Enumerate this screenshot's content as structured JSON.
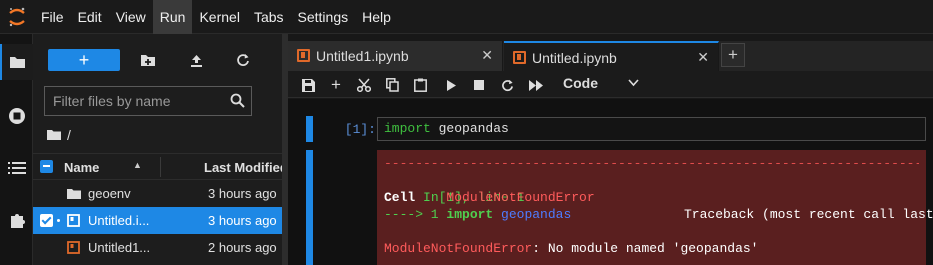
{
  "menu": [
    "File",
    "Edit",
    "View",
    "Run",
    "Kernel",
    "Tabs",
    "Settings",
    "Help"
  ],
  "menu_active": "Run",
  "filebrowser": {
    "new_button_label": "+",
    "filter_placeholder": "Filter files by name",
    "breadcrumb_path": "/",
    "columns": {
      "name": "Name",
      "modified": "Last Modified"
    },
    "files": [
      {
        "name": "geoenv",
        "type": "folder",
        "modified": "3 hours ago",
        "selected": false
      },
      {
        "name": "Untitled.i...",
        "type": "notebook",
        "modified": "3 hours ago",
        "selected": true,
        "running": true
      },
      {
        "name": "Untitled1...",
        "type": "notebook",
        "modified": "2 hours ago",
        "selected": false
      }
    ]
  },
  "tabs": [
    {
      "label": "Untitled1.ipynb",
      "active": false,
      "close": "✕"
    },
    {
      "label": "Untitled.ipynb",
      "active": true,
      "close": "✕"
    }
  ],
  "tab_add_label": "+",
  "toolbar": {
    "cell_type": "Code"
  },
  "cell": {
    "prompt": "[1]:",
    "code_keyword": "import",
    "code_rest": " geopandas",
    "output": {
      "dashes": "---------------------------------------------------------------------------",
      "error_name": "ModuleNotFoundError",
      "traceback_header": "Traceback (most recent call last)",
      "cell_word": "Cell",
      "cell_ref": " In[1], line 1",
      "arrow": "----> 1 ",
      "import_kw": "import",
      "import_mod": " geopandas",
      "final_error_name": "ModuleNotFoundError",
      "final_error_msg": ": No module named 'geopandas'"
    }
  },
  "colors": {
    "accent": "#1e88e5",
    "error_bg": "#5a1f1f",
    "error_text": "#ff5b5b",
    "notebook_icon": "#e0692a"
  }
}
